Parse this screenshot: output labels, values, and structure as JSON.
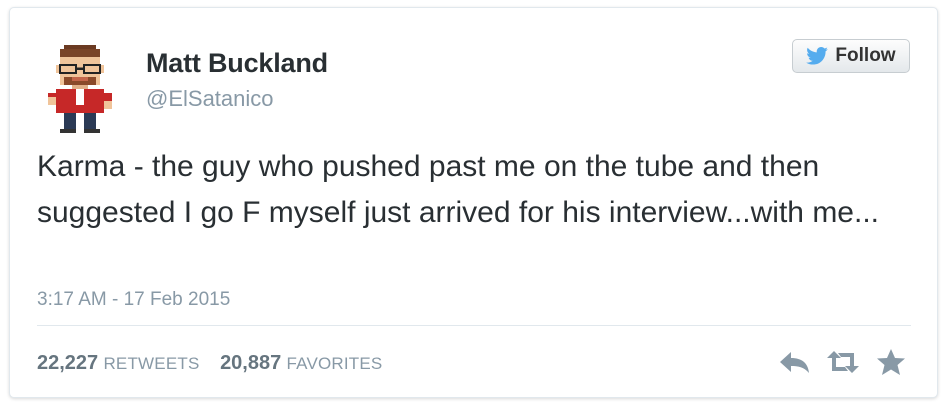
{
  "user": {
    "name": "Matt Buckland",
    "handle": "@ElSatanico"
  },
  "follow_button": {
    "label": "Follow",
    "icon": "twitter-bird-icon"
  },
  "tweet": {
    "text": "Karma - the guy who pushed past me on the tube and then suggested I go F myself just arrived for his interview...with me...",
    "timestamp": "3:17 AM - 17 Feb 2015"
  },
  "stats": {
    "retweets_count": "22,227",
    "retweets_label": "RETWEETS",
    "favorites_count": "20,887",
    "favorites_label": "FAVORITES"
  },
  "actions": [
    "reply-icon",
    "retweet-icon",
    "favorite-icon"
  ],
  "colors": {
    "text": "#292f33",
    "muted": "#8899a6",
    "twitter_blue": "#55acee",
    "border": "#e1e8ed"
  }
}
